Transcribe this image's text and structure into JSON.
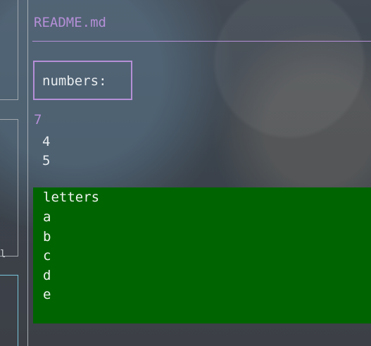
{
  "document": {
    "title": "README.md"
  },
  "left_panes": {
    "label": "l"
  },
  "numbers_section": {
    "heading": "numbers:",
    "first_value": "7",
    "items": [
      "4",
      "5"
    ]
  },
  "letters_section": {
    "heading": "letters",
    "items": [
      "a",
      "b",
      "c",
      "d",
      "e"
    ]
  },
  "colors": {
    "accent_purple": "#b58fd7",
    "letters_panel_green": "#006400",
    "divider_gray": "#a7adb4",
    "cyan_border": "#78c7db"
  }
}
